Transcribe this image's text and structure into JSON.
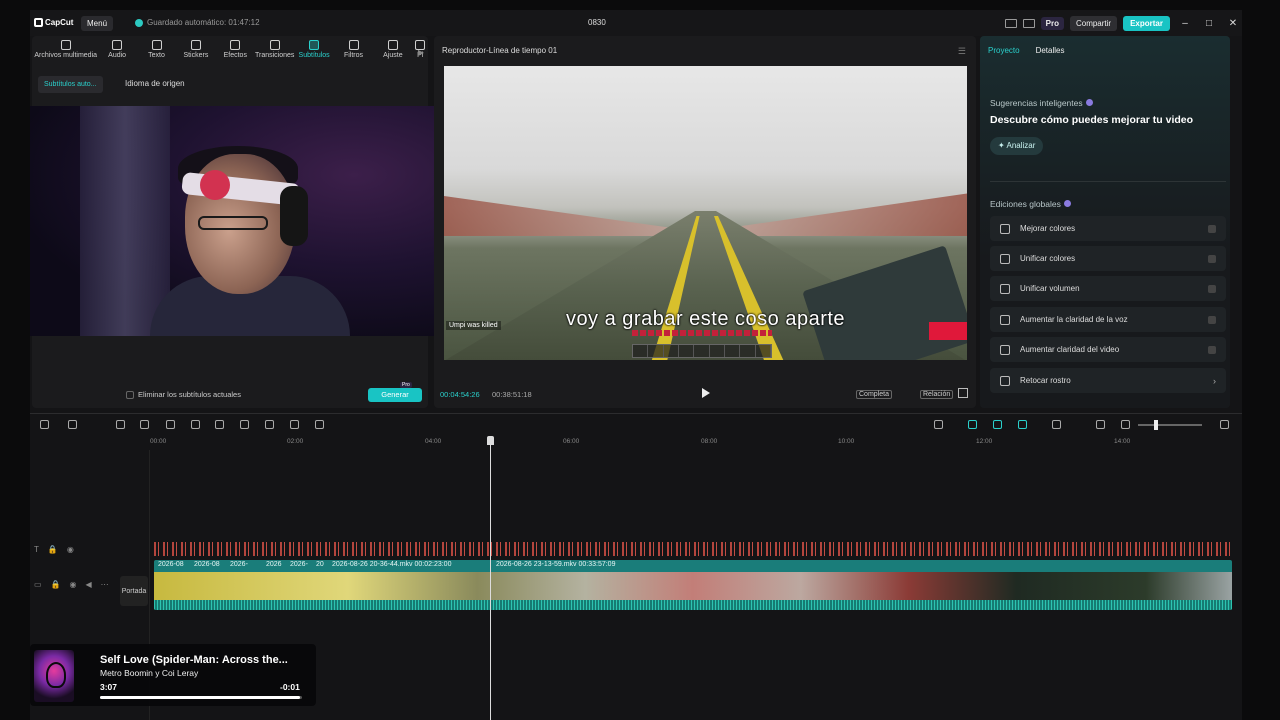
{
  "titlebar": {
    "app_name": "CapCut",
    "menu_label": "Menú",
    "autosave": "Guardado automático: 01:47:12",
    "project_name": "0830",
    "pro_label": "Pro",
    "share_label": "Compartir",
    "export_label": "Exportar",
    "window_controls": [
      "–",
      "□",
      "✕"
    ]
  },
  "media_toolbar": {
    "tools": [
      {
        "label": "Archivos multimedia",
        "icon": "media-icon"
      },
      {
        "label": "Audio",
        "icon": "audio-icon"
      },
      {
        "label": "Texto",
        "icon": "text-icon"
      },
      {
        "label": "Stickers",
        "icon": "stickers-icon"
      },
      {
        "label": "Efectos",
        "icon": "effects-icon"
      },
      {
        "label": "Transiciones",
        "icon": "transitions-icon"
      },
      {
        "label": "Subtítulos",
        "icon": "subtitles-icon",
        "active": true
      },
      {
        "label": "Filtros",
        "icon": "filters-icon"
      },
      {
        "label": "Ajuste",
        "icon": "adjust-icon"
      },
      {
        "label": "Pl",
        "icon": "plugin-icon"
      }
    ]
  },
  "subtitles_panel": {
    "auto_chip": "Subtítulos auto...",
    "source_language_label": "Idioma de origen",
    "remove_existing_label": "Eliminar los subtítulos actuales",
    "generate_label": "Generar",
    "generate_badge": "Pro"
  },
  "player": {
    "title": "Reproductor-Línea de tiempo 01",
    "caption": "voy a grabar este coso aparte",
    "game_message": "Umpi was killed",
    "current_time": "00:04:54:26",
    "total_time": "00:38:51:18",
    "full_label": "Completa",
    "ratio_label": "Relación"
  },
  "right_panel": {
    "tabs": [
      "Proyecto",
      "Detalles"
    ],
    "smart_title": "Sugerencias inteligentes",
    "smart_headline": "Descubre cómo puedes mejorar tu video",
    "analyze_label": "Analizar",
    "global_title": "Ediciones globales",
    "edits": [
      {
        "label": "Mejorar colores",
        "icon": "magic-wand-icon"
      },
      {
        "label": "Unificar colores",
        "icon": "color-match-icon"
      },
      {
        "label": "Unificar volumen",
        "icon": "equalizer-icon"
      },
      {
        "label": "Aumentar la claridad de la voz",
        "icon": "voice-icon"
      },
      {
        "label": "Aumentar claridad del video",
        "icon": "hd-icon"
      },
      {
        "label": "Retocar rostro",
        "icon": "face-retouch-icon"
      }
    ]
  },
  "timeline": {
    "ruler_ticks": [
      "00:00",
      "02:00",
      "04:00",
      "06:00",
      "08:00",
      "10:00",
      "12:00",
      "14:00"
    ],
    "clip_labels": [
      "2026-08",
      "2026-08",
      "2026-",
      "2026",
      "2026-",
      "20",
      "2026-08-26 20-36-44.mkv  00:02:23:00",
      "2026-08-26 23-13-59.mkv  00:33:57:09"
    ],
    "cover_label": "Portada"
  },
  "music_overlay": {
    "title": "Self Love (Spider-Man: Across the...",
    "artist": "Metro Boomin y Coi Leray",
    "elapsed": "3:07",
    "remaining": "-0:01",
    "progress": 0.99
  }
}
